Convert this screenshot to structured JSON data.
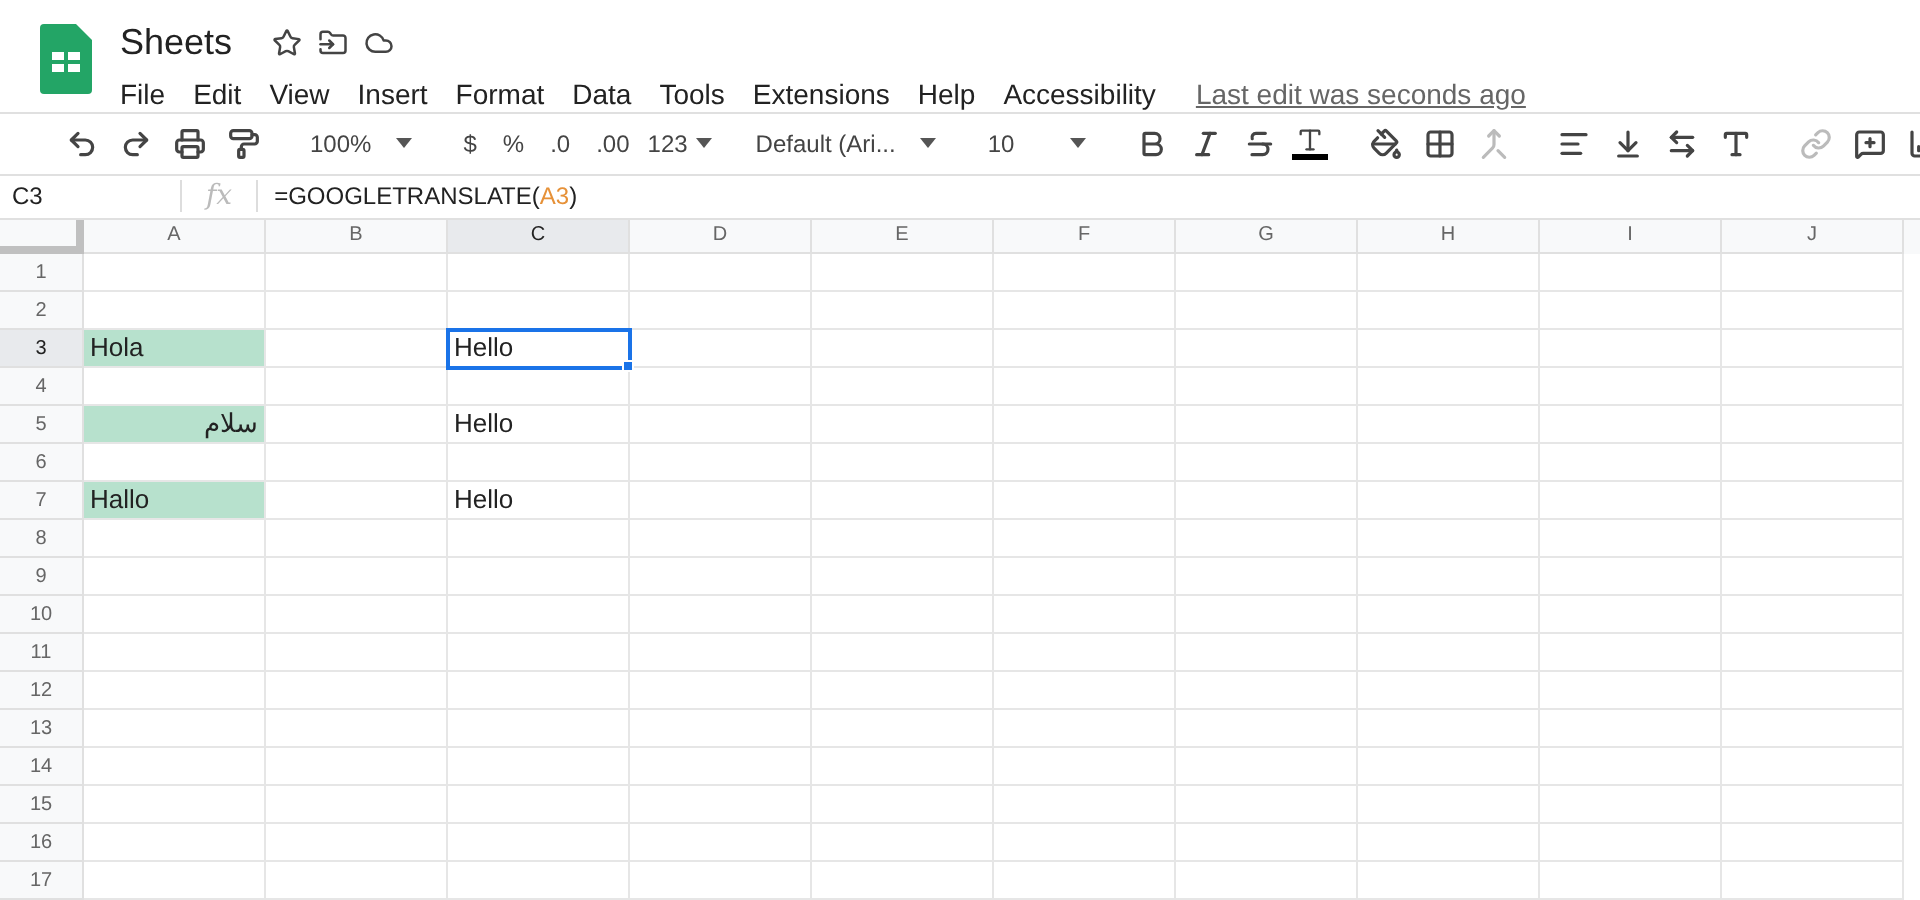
{
  "title": "Sheets",
  "menu": [
    "File",
    "Edit",
    "View",
    "Insert",
    "Format",
    "Data",
    "Tools",
    "Extensions",
    "Help",
    "Accessibility"
  ],
  "last_edit": "Last edit was seconds ago",
  "toolbar": {
    "zoom": "100%",
    "currency": "$",
    "percent": "%",
    "decrease_decimals": ".0",
    "increase_decimals": ".00",
    "number_format": "123",
    "font": "Default (Ari...",
    "font_size": "10"
  },
  "name_box": "C3",
  "function_label": "fx",
  "formula": {
    "before": "=GOOGLETRANSLATE(",
    "ref": "A3",
    "after": ")"
  },
  "columns": [
    {
      "label": "A",
      "selected": false
    },
    {
      "label": "B",
      "selected": false
    },
    {
      "label": "C",
      "selected": true
    },
    {
      "label": "D",
      "selected": false
    },
    {
      "label": "E",
      "selected": false
    },
    {
      "label": "F",
      "selected": false
    },
    {
      "label": "G",
      "selected": false
    },
    {
      "label": "H",
      "selected": false
    },
    {
      "label": "I",
      "selected": false
    },
    {
      "label": "J",
      "selected": false
    }
  ],
  "rows": [
    {
      "label": "1",
      "selected": false
    },
    {
      "label": "2",
      "selected": false
    },
    {
      "label": "3",
      "selected": true,
      "col_a": {
        "text": "Hola",
        "highlighted": true
      },
      "col_c": {
        "text": "Hello",
        "active": true
      }
    },
    {
      "label": "4",
      "selected": false
    },
    {
      "label": "5",
      "selected": false,
      "col_a": {
        "text": "سلام",
        "highlighted": true
      },
      "col_c": {
        "text": "Hello",
        "active": false
      }
    },
    {
      "label": "6",
      "selected": false
    },
    {
      "label": "7",
      "selected": false,
      "col_a": {
        "text": "Hallo",
        "highlighted": true
      },
      "col_c": {
        "text": "Hello",
        "active": false
      }
    },
    {
      "label": "8",
      "selected": false
    },
    {
      "label": "9",
      "selected": false
    },
    {
      "label": "10",
      "selected": false
    },
    {
      "label": "11",
      "selected": false
    },
    {
      "label": "12",
      "selected": false
    },
    {
      "label": "13",
      "selected": false
    },
    {
      "label": "14",
      "selected": false
    },
    {
      "label": "15",
      "selected": false
    },
    {
      "label": "16",
      "selected": false
    },
    {
      "label": "17",
      "selected": false
    }
  ]
}
